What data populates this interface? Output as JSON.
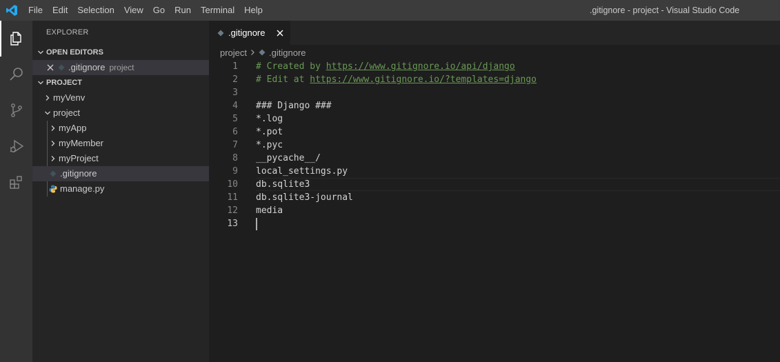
{
  "titlebar": {
    "menu": [
      "File",
      "Edit",
      "Selection",
      "View",
      "Go",
      "Run",
      "Terminal",
      "Help"
    ],
    "window_title": ".gitignore - project - Visual Studio Code"
  },
  "activitybar": {
    "icons": [
      "explorer-icon",
      "search-icon",
      "source-control-icon",
      "run-debug-icon",
      "extensions-icon"
    ]
  },
  "sidebar": {
    "title": "EXPLORER",
    "open_editors": {
      "header": "OPEN EDITORS",
      "items": [
        {
          "name": ".gitignore",
          "description": "project"
        }
      ]
    },
    "project": {
      "header": "PROJECT",
      "items": [
        {
          "label": "myVenv",
          "type": "folder"
        },
        {
          "label": "project",
          "type": "folder-open"
        },
        {
          "label": "myApp",
          "type": "folder"
        },
        {
          "label": "myMember",
          "type": "folder"
        },
        {
          "label": "myProject",
          "type": "folder"
        },
        {
          "label": ".gitignore",
          "type": "file"
        },
        {
          "label": "manage.py",
          "type": "python-file"
        }
      ]
    }
  },
  "editor": {
    "tab_label": ".gitignore",
    "breadcrumb": [
      "project",
      ".gitignore"
    ],
    "lines": [
      {
        "n": "1",
        "prefix": "# Created by ",
        "link": "https://www.gitignore.io/api/django"
      },
      {
        "n": "2",
        "prefix": "# Edit at ",
        "link": "https://www.gitignore.io/?templates=django"
      },
      {
        "n": "3",
        "text": ""
      },
      {
        "n": "4",
        "comment": "### Django ###"
      },
      {
        "n": "5",
        "text": "*.log"
      },
      {
        "n": "6",
        "text": "*.pot"
      },
      {
        "n": "7",
        "text": "*.pyc"
      },
      {
        "n": "8",
        "text": "__pycache__/"
      },
      {
        "n": "9",
        "text": "local_settings.py"
      },
      {
        "n": "10",
        "text": "db.sqlite3"
      },
      {
        "n": "11",
        "text": "db.sqlite3-journal"
      },
      {
        "n": "12",
        "text": "media"
      },
      {
        "n": "13",
        "text": ""
      }
    ]
  },
  "colors": {
    "accent": "#007acc",
    "comment": "#6a9955",
    "titlebar": "#3c3c3c",
    "sidebar": "#252526",
    "editor": "#1e1e1e"
  }
}
